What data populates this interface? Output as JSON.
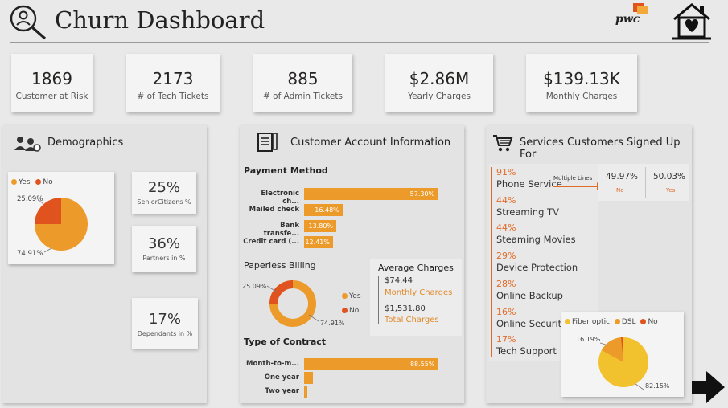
{
  "header": {
    "title": "Churn Dashboard",
    "brand": "pwc"
  },
  "kpis": [
    {
      "value": "1869",
      "label": "Customer at Risk"
    },
    {
      "value": "2173",
      "label": "# of Tech Tickets"
    },
    {
      "value": "885",
      "label": "# of Admin Tickets"
    },
    {
      "value": "$2.86M",
      "label": "Yearly Charges"
    },
    {
      "value": "$139.13K",
      "label": "Monthly Charges"
    }
  ],
  "demographics": {
    "title": "Demographics",
    "legend": [
      "Yes",
      "No"
    ],
    "pie_labels": [
      "25.09%",
      "74.91%"
    ],
    "stats": [
      {
        "value": "25%",
        "label": "SeniorCitizens %"
      },
      {
        "value": "36%",
        "label": "Partners in %"
      },
      {
        "value": "17%",
        "label": "Dependants in %"
      }
    ]
  },
  "account": {
    "title": "Customer Account Information",
    "payment_title": "Payment Method",
    "payment": [
      {
        "label": "Electronic ch...",
        "value": 57.3,
        "text": "57.30%"
      },
      {
        "label": "Mailed check",
        "value": 16.48,
        "text": "16.48%"
      },
      {
        "label": "Bank transfe...",
        "value": 13.8,
        "text": "13.80%"
      },
      {
        "label": "Credit card (...",
        "value": 12.41,
        "text": "12.41%"
      }
    ],
    "paperless_title": "Paperless Billing",
    "paperless_legend": [
      "Yes",
      "No"
    ],
    "paperless_labels": [
      "25.09%",
      "74.91%"
    ],
    "avg_title": "Average Charges",
    "avg_monthly_value": "$74.44",
    "avg_monthly_label": "Monthly Charges",
    "avg_total_value": "$1,531.80",
    "avg_total_label": "Total Charges",
    "contract_title": "Type of Contract",
    "contract": [
      {
        "label": "Month-to-m...",
        "value": 88.55,
        "text": "88.55%"
      },
      {
        "label": "One year",
        "value": 5.6,
        "text": ""
      },
      {
        "label": "Two year",
        "value": 1.4,
        "text": ""
      }
    ]
  },
  "services": {
    "title": "Services Customers Signed Up For",
    "items": [
      {
        "pct": "91%",
        "name": "Phone Service"
      },
      {
        "pct": "44%",
        "name": "Streaming TV"
      },
      {
        "pct": "44%",
        "name": "Steaming Movies"
      },
      {
        "pct": "29%",
        "name": "Device Protection"
      },
      {
        "pct": "28%",
        "name": "Online Backup"
      },
      {
        "pct": "16%",
        "name": "Online Security"
      },
      {
        "pct": "17%",
        "name": "Tech Support"
      }
    ],
    "multiple_lines_label": "Multiple Lines",
    "ml_no_value": "49.97%",
    "ml_no_label": "No",
    "ml_yes_value": "50.03%",
    "ml_yes_label": "Yes",
    "internet_legend": [
      "Fiber optic",
      "DSL",
      "No"
    ],
    "internet_labels": [
      "16.19%",
      "82.15%"
    ]
  },
  "colors": {
    "orange": "#ec9a2a",
    "dark_orange": "#e06b28",
    "yellow": "#f2c12e",
    "red": "#e0531f"
  },
  "icons": [
    "search-user-icon",
    "pwc-logo",
    "home-heart-icon",
    "users-icon",
    "document-icon",
    "cart-icon",
    "arrow-right-icon"
  ],
  "chart_data": [
    {
      "type": "pie",
      "categories": [
        "Yes",
        "No"
      ],
      "values": [
        25.09,
        74.91
      ]
    },
    {
      "type": "bar",
      "categories": [
        "Electronic ch...",
        "Mailed check",
        "Bank transfe...",
        "Credit card (..."
      ],
      "values": [
        57.3,
        16.48,
        13.8,
        12.41
      ]
    },
    {
      "type": "pie",
      "categories": [
        "Yes",
        "No"
      ],
      "values": [
        25.09,
        74.91
      ]
    },
    {
      "type": "bar",
      "categories": [
        "Month-to-m...",
        "One year",
        "Two year"
      ],
      "values": [
        88.55,
        5.6,
        1.4
      ]
    },
    {
      "type": "pie",
      "categories": [
        "Fiber optic",
        "DSL",
        "No"
      ],
      "values": [
        82.15,
        16.19,
        1.66
      ]
    }
  ]
}
